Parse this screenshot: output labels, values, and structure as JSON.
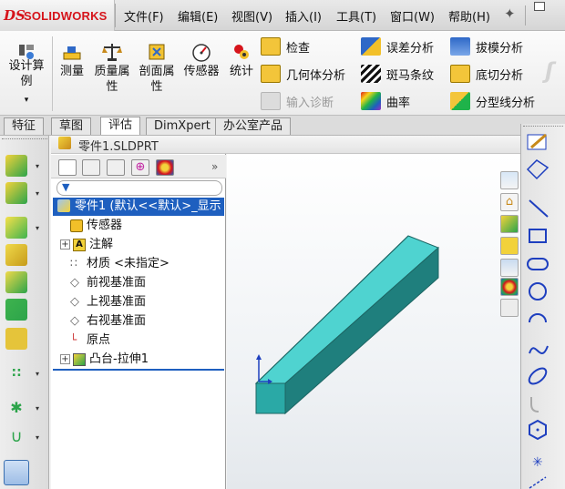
{
  "app": {
    "brand_mark": "DS",
    "brand_name": "SOLIDWORKS"
  },
  "menu": [
    "文件(F)",
    "编辑(E)",
    "视图(V)",
    "插入(I)",
    "工具(T)",
    "窗口(W)",
    "帮助(H)"
  ],
  "ribbon": {
    "design_study": [
      "设计算",
      "例"
    ],
    "measure": "测量",
    "mass_props": [
      "质量属",
      "性"
    ],
    "section_props": [
      "剖面属",
      "性"
    ],
    "sensor": "传感器",
    "statistics": "统计",
    "check": "检查",
    "geometry_analysis": "几何体分析",
    "import_diagnostics": "输入诊断",
    "deviation_analysis": "误差分析",
    "zebra_stripes": "斑马条纹",
    "curvature": "曲率",
    "draft_analysis": "拔模分析",
    "undercut_analysis": "底切分析",
    "parting_line_analysis": "分型线分析"
  },
  "tabs": [
    "特征",
    "草图",
    "评估",
    "DimXpert",
    "办公室产品"
  ],
  "active_tab": "评估",
  "document": {
    "file_name": "零件1.SLDPRT"
  },
  "tree": {
    "root": "零件1 (默认<<默认>_显示",
    "items": [
      "传感器",
      "注解",
      "材质 <未指定>",
      "前视基准面",
      "上视基准面",
      "右视基准面",
      "原点",
      "凸台-拉伸1"
    ]
  },
  "colors": {
    "accent": "#1e5fbf",
    "model": "#2bb6b3",
    "brand": "#d6141b"
  }
}
